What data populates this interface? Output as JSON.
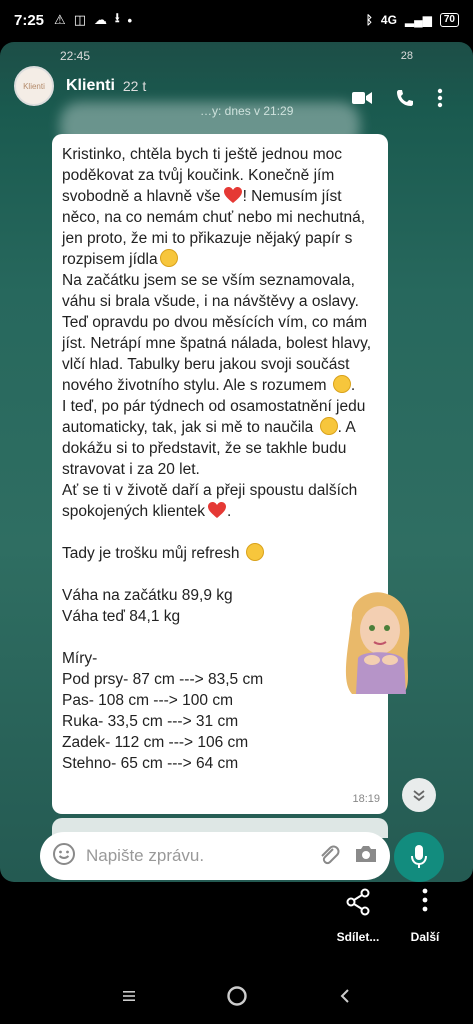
{
  "status_bar": {
    "time": "7:25",
    "battery": "70",
    "signal": "4G"
  },
  "inner_status": {
    "time": "22:45",
    "battery": "28"
  },
  "story": {
    "name": "Klienti",
    "time": "22 t",
    "subtitle": "…y: dnes v 21:29",
    "avatar_text": "Klienti"
  },
  "message": {
    "paragraphs": [
      "Kristinko, chtěla bych ti ještě jednou moc poděkovat za tvůj koučink. Konečně jím svobodně a hlavně vše",
      "! Nemusím jíst něco, na co nemám chuť nebo mi nechutná, jen proto, že mi to přikazuje nějaký papír s rozpisem jídla",
      "Na začátku jsem se se vším seznamovala, váhu si brala všude, i na návštěvy a oslavy. Teď opravdu po dvou měsících vím, co mám jíst. Netrápí mne špatná nálada, bolest hlavy, vlčí hlad. Tabulky beru jakou svoji součást nového životního stylu. Ale s rozumem",
      "I teď, po pár týdnech od osamostatnění jedu automaticky, tak, jak si mě to naučila",
      ". A dokážu si to představit, že se takhle budu stravovat i za 20 let.",
      "Ať se ti v životě daří a přeji spoustu dalších spokojených klientek",
      "Tady je trošku můj refresh"
    ],
    "weight_start": "Váha na začátku 89,9 kg",
    "weight_now": "Váha teď 84,1 kg",
    "measures_title": "Míry-",
    "measures": [
      "Pod prsy- 87 cm ---> 83,5 cm",
      "Pas- 108 cm ---> 100 cm",
      "Ruka- 33,5 cm ---> 31 cm",
      "Zadek- 112 cm ---> 106 cm",
      "Stehno- 65 cm ---> 64 cm"
    ],
    "time": "18:19"
  },
  "input": {
    "placeholder": "Napište zprávu."
  },
  "actions": {
    "share_label": "Sdílet...",
    "more_label": "Další"
  },
  "colors": {
    "accent": "#128c7e",
    "heart": "#e53935",
    "emoji": "#f7c63c"
  }
}
